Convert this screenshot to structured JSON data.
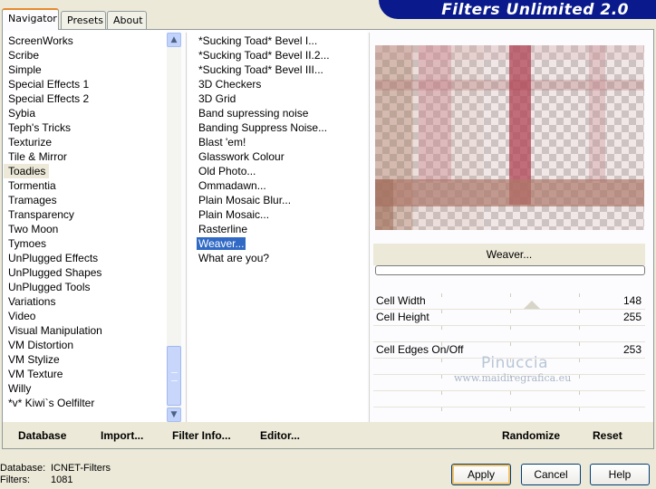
{
  "tabs": [
    {
      "label": "Navigator"
    },
    {
      "label": "Presets"
    },
    {
      "label": "About"
    }
  ],
  "banner": {
    "title": "Filters Unlimited 2.0"
  },
  "categories": [
    "ScreenWorks",
    "Scribe",
    "Simple",
    "Special Effects 1",
    "Special Effects 2",
    "Sybia",
    "Teph's Tricks",
    "Texturize",
    "Tile & Mirror",
    "Toadies",
    "Tormentia",
    "Tramages",
    "Transparency",
    "Two Moon",
    "Tymoes",
    "UnPlugged Effects",
    "UnPlugged Shapes",
    "UnPlugged Tools",
    "Variations",
    "Video",
    "Visual Manipulation",
    "VM Distortion",
    "VM Stylize",
    "VM Texture",
    "Willy",
    "*v* Kiwi`s Oelfilter"
  ],
  "selected_category": "Toadies",
  "filters": [
    "*Sucking Toad*  Bevel I...",
    "*Sucking Toad*  Bevel II.2...",
    "*Sucking Toad*  Bevel III...",
    "3D Checkers",
    "3D Grid",
    "Band supressing noise",
    "Banding Suppress Noise...",
    "Blast 'em!",
    "Glasswork Colour",
    "Old Photo...",
    "Ommadawn...",
    "Plain Mosaic Blur...",
    "Plain Mosaic...",
    "Rasterline",
    "Weaver...",
    "What are you?"
  ],
  "selected_filter": "Weaver...",
  "preview": {
    "filter_name": "Weaver..."
  },
  "params": [
    {
      "label": "Cell Width",
      "value": "148"
    },
    {
      "label": "Cell Height",
      "value": "255"
    },
    {
      "label": "",
      "value": ""
    },
    {
      "label": "Cell Edges On/Off",
      "value": "253"
    },
    {
      "label": "",
      "value": ""
    },
    {
      "label": "",
      "value": ""
    },
    {
      "label": "",
      "value": ""
    },
    {
      "label": "",
      "value": ""
    }
  ],
  "watermark": {
    "name": "Pinuccia",
    "url": "www.maidiregrafica.eu"
  },
  "panel_buttons": {
    "database": "Database",
    "import": "Import...",
    "filter_info": "Filter Info...",
    "editor": "Editor...",
    "randomize": "Randomize",
    "reset": "Reset"
  },
  "footer": {
    "database_key": "Database:",
    "database_value": "ICNET-Filters",
    "filters_key": "Filters:",
    "filters_value": "1081"
  },
  "dialog_buttons": {
    "apply": "Apply",
    "cancel": "Cancel",
    "help": "Help"
  },
  "colors": {
    "banner": "#0a1a8c",
    "selection": "#316ac5",
    "tab_accent": "#e68b2c"
  }
}
